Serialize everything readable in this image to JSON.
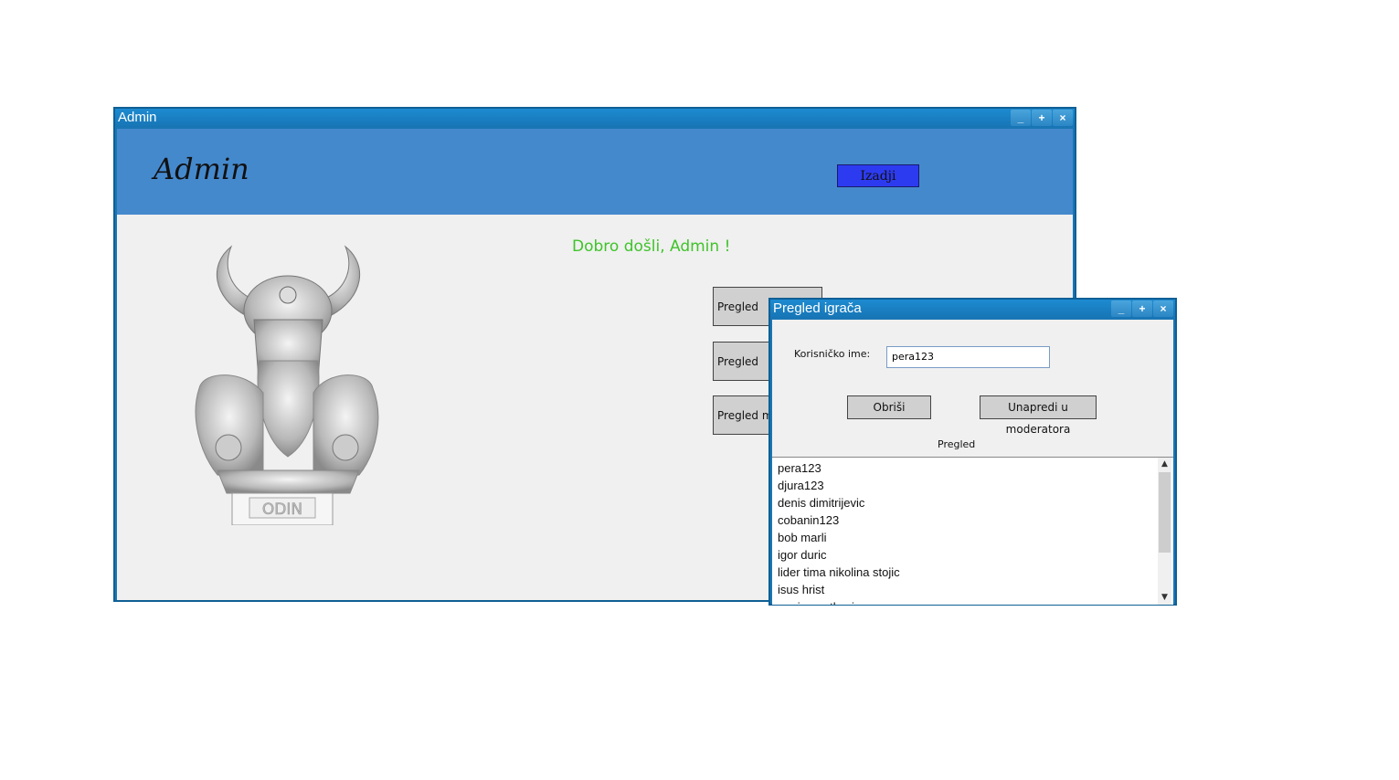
{
  "main_window": {
    "title": "Admin",
    "controls": [
      "_",
      "+",
      "×"
    ],
    "header_title": "Admin",
    "exit_label": "Izadji",
    "welcome": "Dobro došli, Admin !",
    "logo_text": "ODIN",
    "buttons": [
      "Pregled",
      "Pregled",
      "Pregled mo"
    ]
  },
  "dialog": {
    "title": "Pregled igrača",
    "controls": [
      "_",
      "+",
      "×"
    ],
    "username_label": "Korisničko ime:",
    "username_value": "pera123",
    "delete_label": "Obriši",
    "promote_label": "Unapredi u moderatora",
    "list_label": "Pregled",
    "players": [
      "pera123",
      "djura123",
      "denis dimitrijevic",
      "cobanin123",
      "bob marli",
      "igor duric",
      "lider tima nikolina stojic",
      "isus hrist",
      "ognjen petkovic"
    ]
  }
}
